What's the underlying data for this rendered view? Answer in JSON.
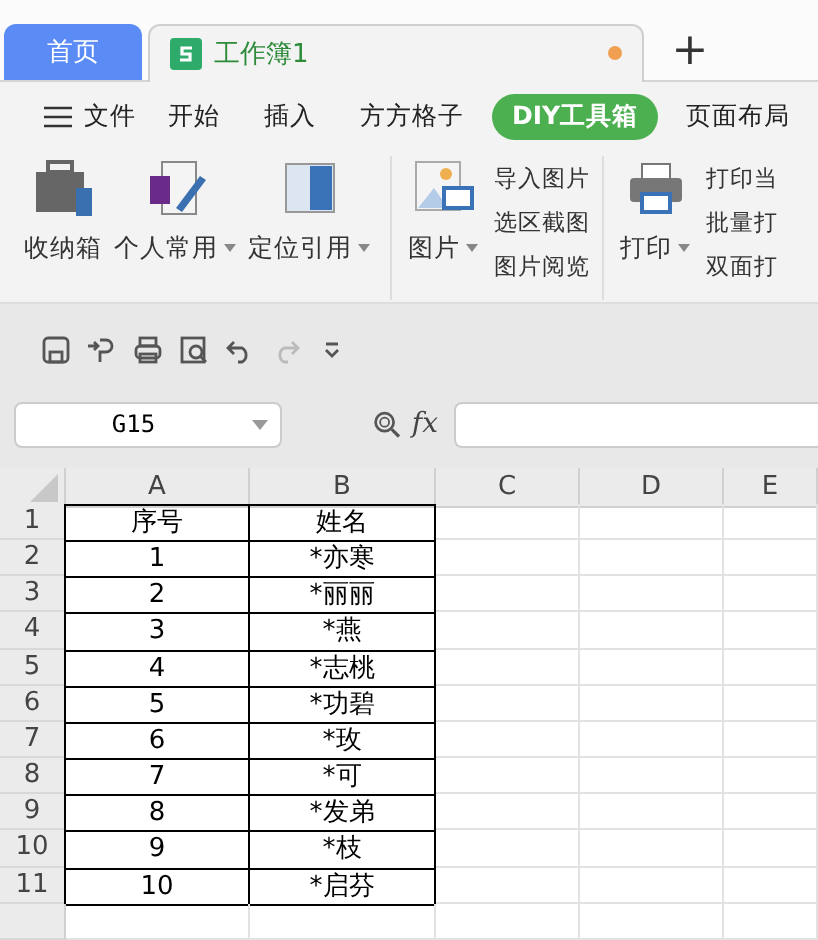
{
  "tabs": [
    {
      "label": "首页",
      "kind": "home",
      "selected": false,
      "modified": false
    },
    {
      "label": "工作簿1",
      "kind": "sheet",
      "selected": true,
      "modified": true
    }
  ],
  "new_tab": "+",
  "menu": [
    {
      "label": "文件",
      "kind": "file",
      "selected": false
    },
    {
      "label": "开始",
      "kind": "tab",
      "selected": false
    },
    {
      "label": "插入",
      "kind": "tab",
      "selected": false
    },
    {
      "label": "方方格子",
      "kind": "tab",
      "selected": false
    },
    {
      "label": "DIY工具箱",
      "kind": "tab",
      "selected": true
    },
    {
      "label": "页面布局",
      "kind": "tab",
      "selected": false
    }
  ],
  "ribbon": [
    {
      "kind": "big",
      "label": "收纳箱",
      "dropdown": false
    },
    {
      "kind": "big",
      "label": "个人常用",
      "dropdown": true
    },
    {
      "kind": "big",
      "label": "定位引用",
      "dropdown": true
    },
    {
      "kind": "separator"
    },
    {
      "kind": "big",
      "label": "图片",
      "dropdown": true
    },
    {
      "kind": "stack",
      "items": [
        "导入图片",
        "选区截图",
        "图片阅览"
      ]
    },
    {
      "kind": "separator"
    },
    {
      "kind": "big",
      "label": "打印",
      "dropdown": true
    },
    {
      "kind": "stack",
      "items": [
        "打印当",
        "批量打",
        "双面打"
      ]
    }
  ],
  "quick_access": [
    {
      "disabled": false
    },
    {
      "disabled": false
    },
    {
      "disabled": false
    },
    {
      "disabled": false
    },
    {
      "disabled": false
    },
    {
      "disabled": true
    },
    {
      "disabled": false
    }
  ],
  "name_box": "G15",
  "formula_label": "fx",
  "sheet": {
    "columns": [
      "A",
      "B",
      "C",
      "D",
      "E"
    ],
    "rows": [
      {
        "number": "1",
        "cells": [
          "序号",
          "姓名"
        ]
      },
      {
        "number": "2",
        "cells": [
          "1",
          "*亦寒"
        ]
      },
      {
        "number": "3",
        "cells": [
          "2",
          "*丽丽"
        ]
      },
      {
        "number": "4",
        "cells": [
          "3",
          "*燕"
        ]
      },
      {
        "number": "5",
        "cells": [
          "4",
          "*志桃"
        ]
      },
      {
        "number": "6",
        "cells": [
          "5",
          "*功碧"
        ]
      },
      {
        "number": "7",
        "cells": [
          "6",
          "*玫"
        ]
      },
      {
        "number": "8",
        "cells": [
          "7",
          "*可"
        ]
      },
      {
        "number": "9",
        "cells": [
          "8",
          "*发弟"
        ]
      },
      {
        "number": "10",
        "cells": [
          "9",
          "*枝"
        ]
      },
      {
        "number": "11",
        "cells": [
          "10",
          "*启芬"
        ]
      }
    ]
  }
}
